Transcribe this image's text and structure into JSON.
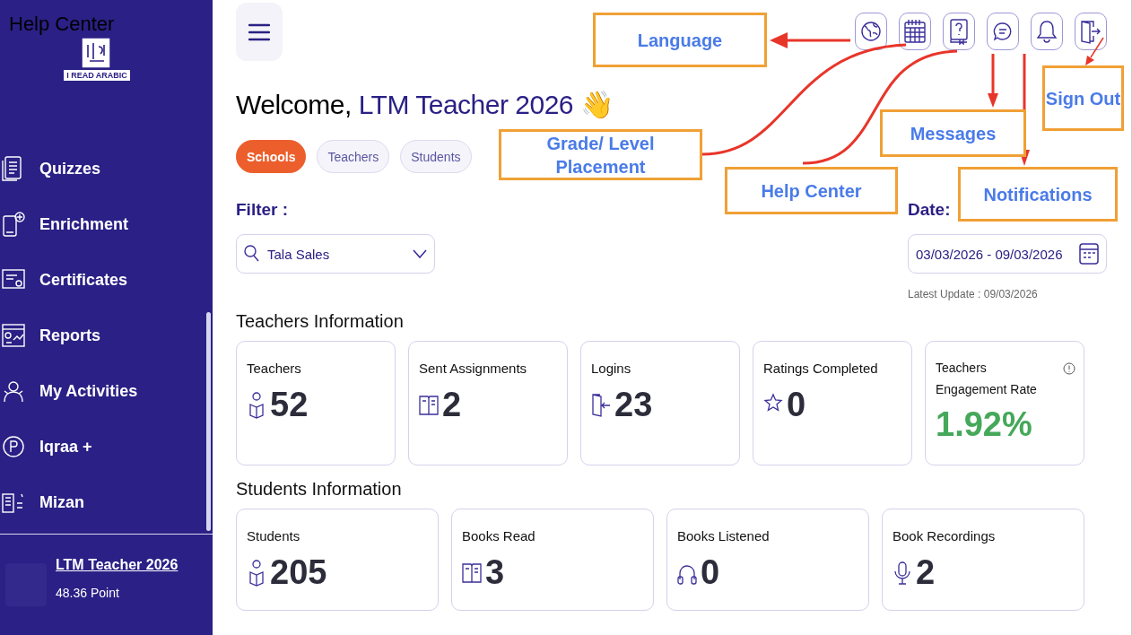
{
  "overlay_label": "Help Center",
  "sidebar": {
    "logo_text": "I READ ARABIC",
    "items": [
      {
        "label": "Quizzes"
      },
      {
        "label": "Enrichment"
      },
      {
        "label": "Certificates"
      },
      {
        "label": "Reports"
      },
      {
        "label": "My Activities"
      },
      {
        "label": "Iqraa +"
      },
      {
        "label": "Mizan"
      }
    ],
    "user": {
      "name": "LTM Teacher 2026",
      "points": "48.36 Point"
    }
  },
  "welcome": {
    "greeting": "Welcome,",
    "name": "LTM Teacher 2026",
    "emoji": "👋"
  },
  "tabs": [
    {
      "label": "Schools",
      "selected": true
    },
    {
      "label": "Teachers",
      "selected": false
    },
    {
      "label": "Students",
      "selected": false
    }
  ],
  "filter": {
    "label": "Filter :",
    "value": "Tala Sales"
  },
  "date": {
    "label": "Date:",
    "value": "03/03/2026 - 09/03/2026",
    "latest_update": "Latest Update : 09/03/2026"
  },
  "teachers_information": {
    "title": "Teachers Information",
    "cards": [
      {
        "label": "Teachers",
        "value": "52",
        "kind": "count"
      },
      {
        "label": "Sent Assignments",
        "value": "2",
        "kind": "count"
      },
      {
        "label": "Logins",
        "value": "23",
        "kind": "count"
      },
      {
        "label": "Ratings Completed",
        "value": "0",
        "kind": "count"
      },
      {
        "label": "Teachers Engagement Rate",
        "value": "1.92%",
        "kind": "rate"
      }
    ]
  },
  "students_information": {
    "title": "Students Information",
    "cards": [
      {
        "label": "Students",
        "value": "205",
        "kind": "count"
      },
      {
        "label": "Books Read",
        "value": "3",
        "kind": "count"
      },
      {
        "label": "Books Listened",
        "value": "0",
        "kind": "count"
      },
      {
        "label": "Book Recordings",
        "value": "2",
        "kind": "count"
      }
    ]
  },
  "annotations": [
    {
      "label": "Language"
    },
    {
      "label": "Grade/ Level Placement"
    },
    {
      "label": "Help Center"
    },
    {
      "label": "Messages"
    },
    {
      "label": "Notifications"
    },
    {
      "label": "Sign Out"
    }
  ]
}
